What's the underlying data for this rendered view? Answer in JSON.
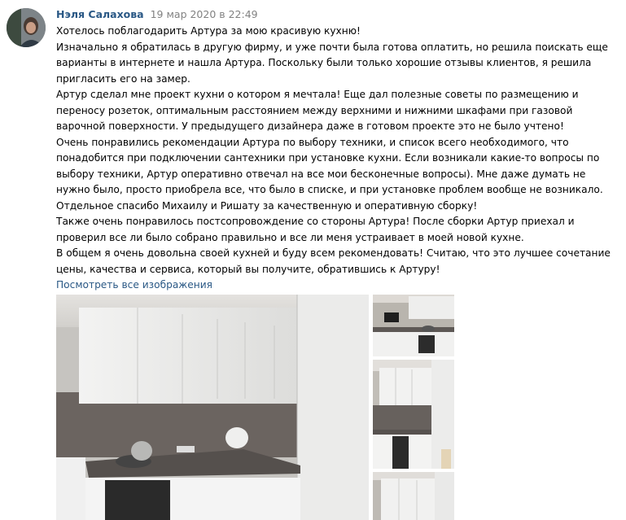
{
  "comment": {
    "author": "Нэля Салахова",
    "date": "19 мар 2020 в 22:49",
    "paragraphs": [
      "Хотелось поблагодарить Артура за мою красивую кухню!",
      "Изначально я обратилась в другую фирму, и уже почти была готова оплатить, но решила поискать еще варианты в интернете и нашла Артура. Поскольку были только хорошие отзывы клиентов, я решила пригласить его на замер.",
      "Артур сделал мне проект кухни о котором я мечтала! Еще дал полезные советы по размещению и переносу розеток, оптимальным расстоянием между верхними и нижними шкафами при газовой варочной поверхности. У предыдущего дизайнера даже в готовом проекте это не было учтено!",
      "Очень понравились рекомендации Артура по выбору техники, и список всего необходимого, что понадобится при подключении сантехники при установке кухни. Если возникали какие-то вопросы по выбору техники, Артур оперативно отвечал на все мои бесконечные вопросы). Мне даже думать не нужно было, просто приобрела все, что было в списке, и при установке проблем вообще не возникало.",
      "Отдельное спасибо Михаилу и Ришату за качественную и оперативную сборку!",
      "Также очень понравилось постсопровождение со стороны Артура! После сборки Артур приехал и проверил все ли было собрано правильно и все ли меня устраивает в моей новой кухне.",
      "В общем я очень довольна своей кухней и буду всем рекомендовать! Считаю, что это лучшее сочетание цены, качества и сервиса, который вы получите, обратившись к Артуру!"
    ],
    "show_all_link": "Посмотреть все изображения"
  },
  "colors": {
    "link": "#2a5885",
    "date": "#828282",
    "text": "#000000"
  }
}
